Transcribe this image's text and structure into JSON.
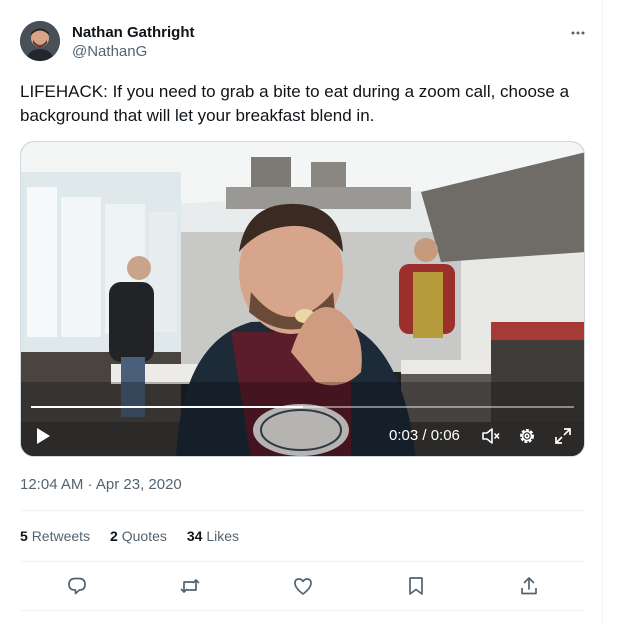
{
  "author": {
    "name": "Nathan Gathright",
    "handle": "@NathanG"
  },
  "tweet": {
    "text": "LIFEHACK: If you need to grab a bite to eat during a zoom call, choose a background that will let your breakfast blend in.",
    "timestamp": "12:04 AM · Apr 23, 2020"
  },
  "video": {
    "time_display": "0:03 / 0:06",
    "progress_fraction": 0.5
  },
  "stats": {
    "retweets_count": "5",
    "retweets_label": "Retweets",
    "quotes_count": "2",
    "quotes_label": "Quotes",
    "likes_count": "34",
    "likes_label": "Likes"
  },
  "icons": {
    "more": "more-horizontal-icon",
    "play": "play-icon",
    "mute": "mute-icon",
    "settings": "settings-gear-icon",
    "fullscreen": "fullscreen-icon",
    "reply": "reply-icon",
    "retweet": "retweet-icon",
    "like": "heart-icon",
    "bookmark": "bookmark-icon",
    "share": "share-icon"
  },
  "colors": {
    "text_primary": "#0f1419",
    "text_secondary": "#536471",
    "divider": "#eff3f4",
    "action_icon": "#536471"
  }
}
